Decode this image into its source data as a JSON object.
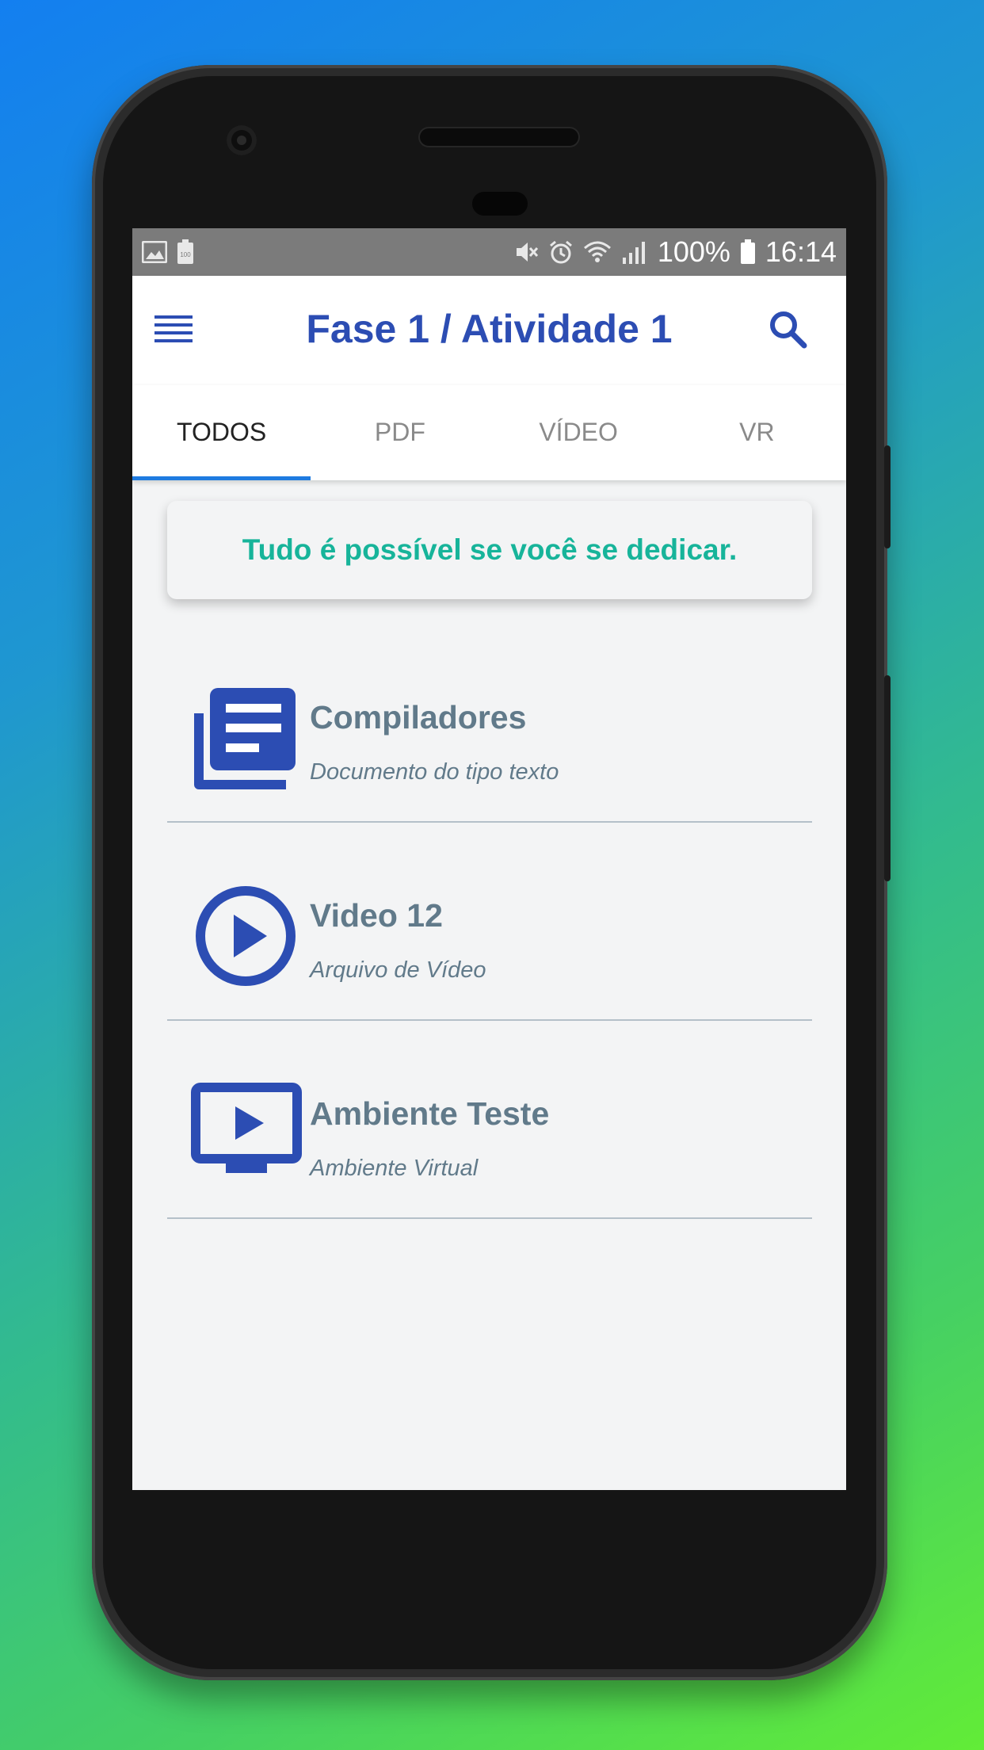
{
  "status_bar": {
    "left_icons": [
      "image-icon",
      "battery-saver-icon"
    ],
    "right_icons": [
      "mute-icon",
      "alarm-icon",
      "wifi-icon",
      "signal-icon"
    ],
    "battery": "100%",
    "time": "16:14"
  },
  "app_bar": {
    "title": "Fase 1 / Atividade 1",
    "menu_icon": "menu-icon",
    "search_icon": "search-icon",
    "accent_color": "#2c4db3"
  },
  "tabs": [
    {
      "label": "TODOS",
      "active": true
    },
    {
      "label": "PDF",
      "active": false
    },
    {
      "label": "VÍDEO",
      "active": false
    },
    {
      "label": "VR",
      "active": false
    }
  ],
  "motivation": {
    "text": "Tudo é possível se você se dedicar.",
    "color": "#17b49a"
  },
  "items": [
    {
      "title": "Compiladores",
      "subtitle": "Documento do tipo texto",
      "icon": "document-icon"
    },
    {
      "title": "Video 12",
      "subtitle": "Arquivo de Vídeo",
      "icon": "play-circle-icon"
    },
    {
      "title": "Ambiente Teste",
      "subtitle": "Ambiente Virtual",
      "icon": "tv-play-icon"
    }
  ]
}
